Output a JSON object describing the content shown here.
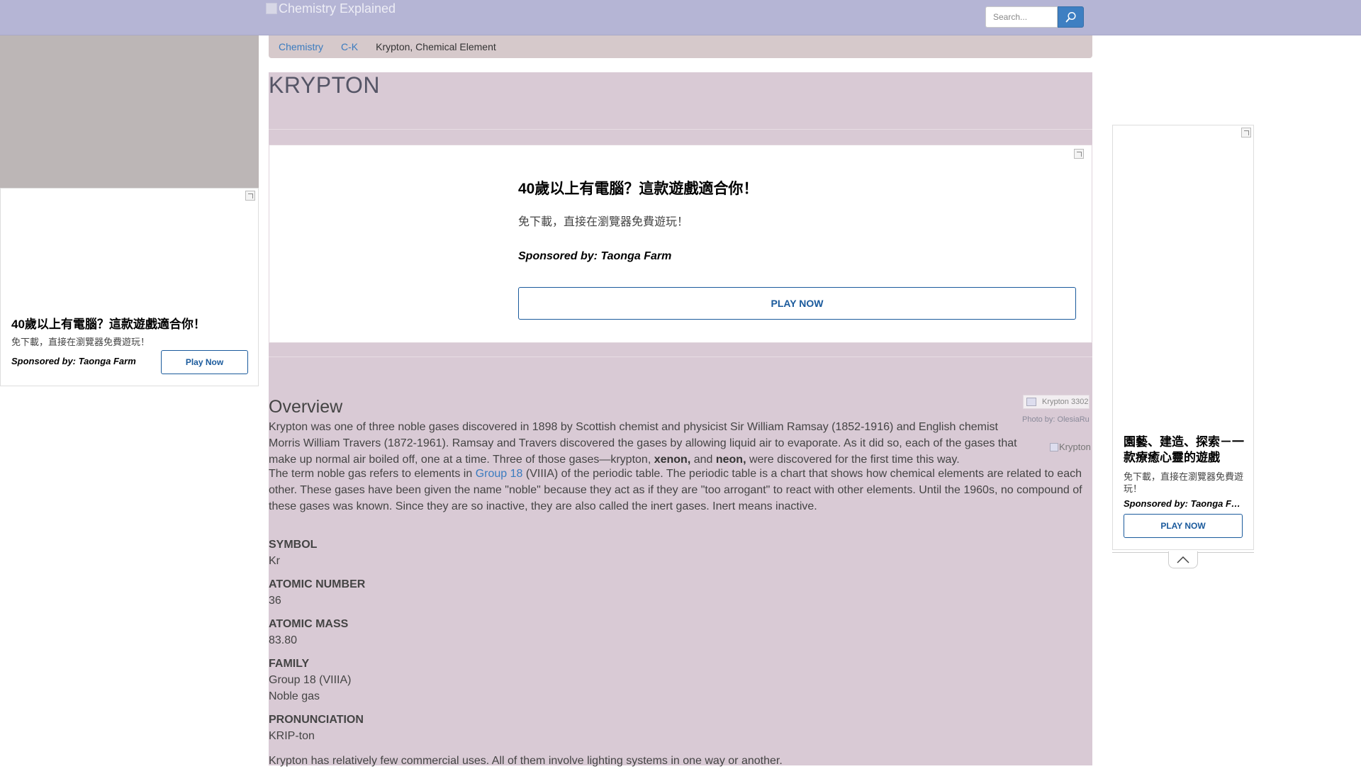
{
  "header": {
    "logo_alt": "Chemistry Explained",
    "search_placeholder": "Search..."
  },
  "breadcrumb": {
    "items": [
      "Chemistry",
      "C-K"
    ],
    "current": "Krypton, Chemical Element"
  },
  "page": {
    "title": "KRYPTON"
  },
  "ads": {
    "left": {
      "title": "40歲以上有電腦？這款遊戲適合你！",
      "subtitle": "免下載，直接在瀏覽器免費遊玩！",
      "sponsor": "Sponsored by: Taonga Farm",
      "button": "Play Now"
    },
    "content": {
      "title": "40歲以上有電腦？這款遊戲適合你！",
      "subtitle": "免下載，直接在瀏覽器免費遊玩！",
      "sponsor": "Sponsored by: Taonga Farm",
      "button": "PLAY NOW"
    },
    "right": {
      "title": "園藝、建造、探索－一款療癒心靈的遊戲",
      "subtitle": "免下載，直接在瀏覽器免費遊玩！",
      "sponsor": "Sponsored by: Taonga Farm",
      "button": "PLAY NOW"
    }
  },
  "article": {
    "overview_heading": "Overview",
    "photo": {
      "caption": "Krypton 3302",
      "credit_prefix": "Photo by: ",
      "credit_name": "OlesiaRu",
      "image_alt": "Krypton"
    },
    "p1_text": "Krypton was one of three noble gases discovered in 1898 by Scottish chemist and physicist Sir William Ramsay (1852-1916) and English chemist Morris William Travers (1872-1961). Ramsay and Travers discovered the gases by allowing liquid air to evaporate. As it did so, each of the gases that make up normal air boiled off, one at a time. Three of those gases—krypton, ",
    "p1_bold1": "xenon,",
    "p1_mid": " and ",
    "p1_bold2": "neon,",
    "p1_end": " were discovered for the first time this way.",
    "p2_start": "The term noble gas refers to elements in ",
    "p2_link": "Group 18",
    "p2_end": " (VIIIA) of the periodic table. The periodic table is a chart that shows how chemical elements are related to each other. These gases have been given the name \"noble\" because they act as if they are \"too arrogant\" to react with other elements. Until the 1960s, no compound of these gases was known. Since they are so inactive, they are also called the inert gases. Inert means inactive.",
    "facts": {
      "symbol_label": "SYMBOL",
      "symbol": "Kr",
      "atomic_number_label": "ATOMIC NUMBER",
      "atomic_number": "36",
      "atomic_mass_label": "ATOMIC MASS",
      "atomic_mass": "83.80",
      "family_label": "FAMILY",
      "family_1": "Group 18 (VIIIA)",
      "family_2": "Noble gas",
      "pronunciation_label": "PRONUNCIATION",
      "pronunciation": "KRIP-ton"
    },
    "p3_text": "Krypton has relatively few commercial uses. All of them involve lighting systems in one way or another."
  }
}
